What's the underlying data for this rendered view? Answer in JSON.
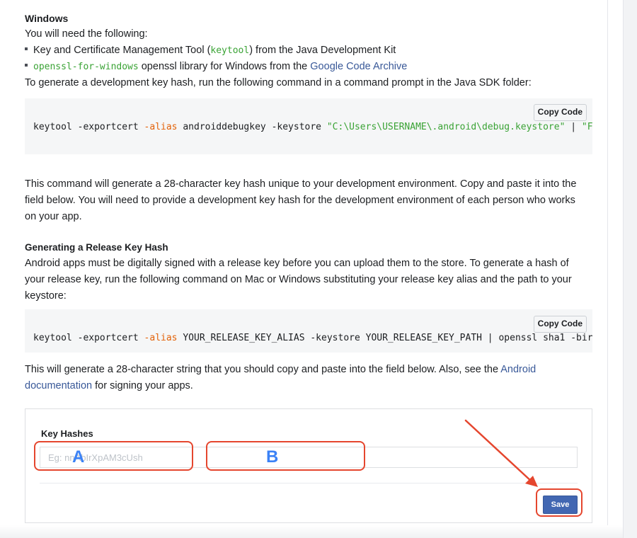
{
  "windows": {
    "heading": "Windows",
    "need_text": "You will need the following:",
    "bullet1": {
      "pre": "Key and Certificate Management Tool (",
      "code": "keytool",
      "post": ") from the Java Development Kit"
    },
    "bullet2": {
      "code": "openssl-for-windows",
      "mid": " openssl library for Windows from the ",
      "link": "Google Code Archive"
    },
    "generate_text": "To generate a development key hash, run the following command in a command prompt in the Java SDK folder:"
  },
  "command1": {
    "copy_label": "Copy Code",
    "part1": "keytool -exportcert ",
    "flag": "-alias",
    "part2": " androiddebugkey -keystore ",
    "str1": "\"C:\\Users\\USERNAME\\.android\\debug.keystore\"",
    "part3": " | ",
    "str2": "\"F"
  },
  "paragraph_dev": {
    "line1": "This command will generate a 28-character key hash unique to your development environment. Copy and paste it into the",
    "line2": "field below. You will need to provide a development key hash for the development environment of each person who works",
    "line3": "on your app."
  },
  "release": {
    "heading": "Generating a Release Key Hash",
    "line1": "Android apps must be digitally signed with a release key before you can upload them to the store. To generate a hash of",
    "line2": "your release key, run the following command on Mac or Windows substituting your release key alias and the path to your",
    "line3": "keystore:"
  },
  "command2": {
    "copy_label": "Copy Code",
    "part1": "keytool -exportcert ",
    "flag": "-alias",
    "part2": " YOUR_RELEASE_KEY_ALIAS -keystore YOUR_RELEASE_KEY_PATH | openssl sha1 -bir"
  },
  "paragraph_release": {
    "pre": "This will generate a 28-character string that you should copy and paste into the field below. Also, see the ",
    "link1": "Android",
    "link2": "documentation",
    "post": " for signing your apps."
  },
  "key_hashes": {
    "label": "Key Hashes",
    "placeholder": "Eg: nnAbIrXpAM3cUsh",
    "save_label": "Save"
  },
  "annotations": {
    "a_label": "A",
    "b_label": "B",
    "color": "#e5462e",
    "letter_color": "#3b82f6"
  },
  "colors": {
    "link": "#385898",
    "code_green": "#3aa335",
    "flag_orange": "#e36209",
    "save_button": "#4267b2"
  }
}
